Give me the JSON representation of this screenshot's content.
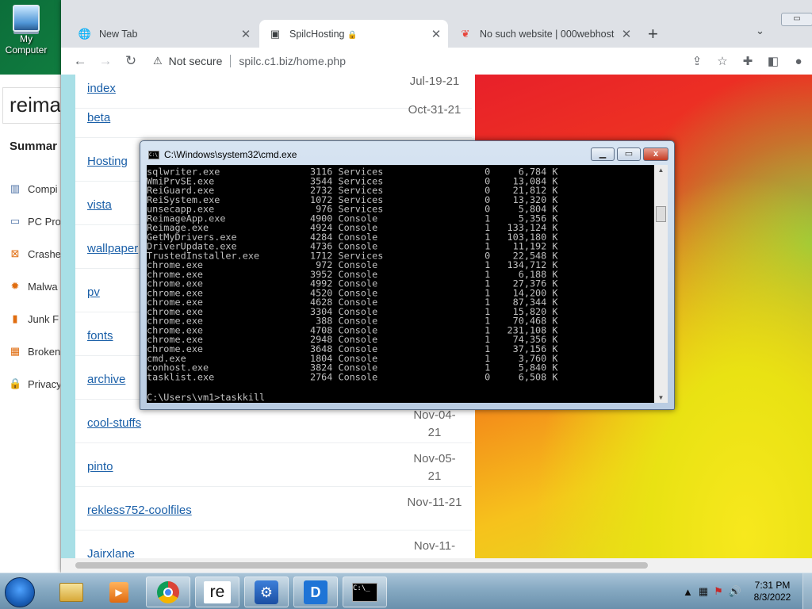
{
  "desktop": {
    "icon_label_1": "My",
    "icon_label_2": "Computer"
  },
  "browser": {
    "tabs": [
      {
        "title": "New Tab",
        "favicon": "globe-icon"
      },
      {
        "title": "SpilcHosting",
        "favicon": "site-icon",
        "lock": "🔒"
      },
      {
        "title": "No such website | 000webhost",
        "favicon": "webhost-icon"
      }
    ],
    "new_tab_label": "+",
    "tab_search_label": "⌄",
    "address": {
      "warning": "Not secure",
      "url": "spilc.c1.biz/home.php"
    }
  },
  "reimage": {
    "logo": "reimag",
    "summary": "Summar",
    "items": [
      "Compi",
      "PC Pro",
      "Crashe",
      "Malwa",
      "Junk F",
      "Broken",
      "Privacy"
    ]
  },
  "listing": {
    "rows": [
      {
        "name": "index",
        "date": "Jul-19-21"
      },
      {
        "name": "beta",
        "date": "Oct-31-21"
      },
      {
        "name": "Hosting",
        "date": ""
      },
      {
        "name": "vista",
        "date": ""
      },
      {
        "name": "wallpaper",
        "date": ""
      },
      {
        "name": "pv",
        "date": ""
      },
      {
        "name": "fonts",
        "date": ""
      },
      {
        "name": "archive",
        "date": ""
      },
      {
        "name": "cool-stuffs",
        "date": "Nov-04-21"
      },
      {
        "name": "pinto",
        "date": "Nov-05-21"
      },
      {
        "name": "rekless752-coolfiles",
        "date": "Nov-11-21"
      },
      {
        "name": "Jairxlane",
        "date": "Nov-11-"
      }
    ]
  },
  "cmd": {
    "title": "C:\\Windows\\system32\\cmd.exe",
    "close_label": "x",
    "processes": [
      {
        "image": "sqlwriter.exe",
        "pid": "3116",
        "session": "Services",
        "num": "0",
        "mem": "6,784 K"
      },
      {
        "image": "WmiPrvSE.exe",
        "pid": "3544",
        "session": "Services",
        "num": "0",
        "mem": "13,084 K"
      },
      {
        "image": "ReiGuard.exe",
        "pid": "2732",
        "session": "Services",
        "num": "0",
        "mem": "21,812 K"
      },
      {
        "image": "ReiSystem.exe",
        "pid": "1072",
        "session": "Services",
        "num": "0",
        "mem": "13,320 K"
      },
      {
        "image": "unsecapp.exe",
        "pid": "976",
        "session": "Services",
        "num": "0",
        "mem": "5,804 K"
      },
      {
        "image": "ReimageApp.exe",
        "pid": "4900",
        "session": "Console",
        "num": "1",
        "mem": "5,356 K"
      },
      {
        "image": "Reimage.exe",
        "pid": "4924",
        "session": "Console",
        "num": "1",
        "mem": "133,124 K"
      },
      {
        "image": "GetMyDrivers.exe",
        "pid": "4284",
        "session": "Console",
        "num": "1",
        "mem": "103,180 K"
      },
      {
        "image": "DriverUpdate.exe",
        "pid": "4736",
        "session": "Console",
        "num": "1",
        "mem": "11,192 K"
      },
      {
        "image": "TrustedInstaller.exe",
        "pid": "1712",
        "session": "Services",
        "num": "0",
        "mem": "22,548 K"
      },
      {
        "image": "chrome.exe",
        "pid": "972",
        "session": "Console",
        "num": "1",
        "mem": "134,712 K"
      },
      {
        "image": "chrome.exe",
        "pid": "3952",
        "session": "Console",
        "num": "1",
        "mem": "6,188 K"
      },
      {
        "image": "chrome.exe",
        "pid": "4992",
        "session": "Console",
        "num": "1",
        "mem": "27,376 K"
      },
      {
        "image": "chrome.exe",
        "pid": "4520",
        "session": "Console",
        "num": "1",
        "mem": "14,200 K"
      },
      {
        "image": "chrome.exe",
        "pid": "4628",
        "session": "Console",
        "num": "1",
        "mem": "87,344 K"
      },
      {
        "image": "chrome.exe",
        "pid": "3304",
        "session": "Console",
        "num": "1",
        "mem": "15,820 K"
      },
      {
        "image": "chrome.exe",
        "pid": "388",
        "session": "Console",
        "num": "1",
        "mem": "70,468 K"
      },
      {
        "image": "chrome.exe",
        "pid": "4708",
        "session": "Console",
        "num": "1",
        "mem": "231,108 K"
      },
      {
        "image": "chrome.exe",
        "pid": "2948",
        "session": "Console",
        "num": "1",
        "mem": "74,356 K"
      },
      {
        "image": "chrome.exe",
        "pid": "3648",
        "session": "Console",
        "num": "1",
        "mem": "37,156 K"
      },
      {
        "image": "cmd.exe",
        "pid": "1804",
        "session": "Console",
        "num": "1",
        "mem": "3,760 K"
      },
      {
        "image": "conhost.exe",
        "pid": "3824",
        "session": "Console",
        "num": "1",
        "mem": "5,840 K"
      },
      {
        "image": "tasklist.exe",
        "pid": "2764",
        "session": "Console",
        "num": "0",
        "mem": "6,508 K"
      }
    ],
    "prompt": "C:\\Users\\vm1>taskkill"
  },
  "taskbar": {
    "apps": [
      "file-explorer-icon",
      "media-player-icon",
      "chrome-icon",
      "reimage-icon",
      "settings-shield-icon",
      "driver-icon",
      "cmd-icon"
    ],
    "reimage_label": "re",
    "time": "7:31 PM",
    "date": "8/3/2022"
  }
}
